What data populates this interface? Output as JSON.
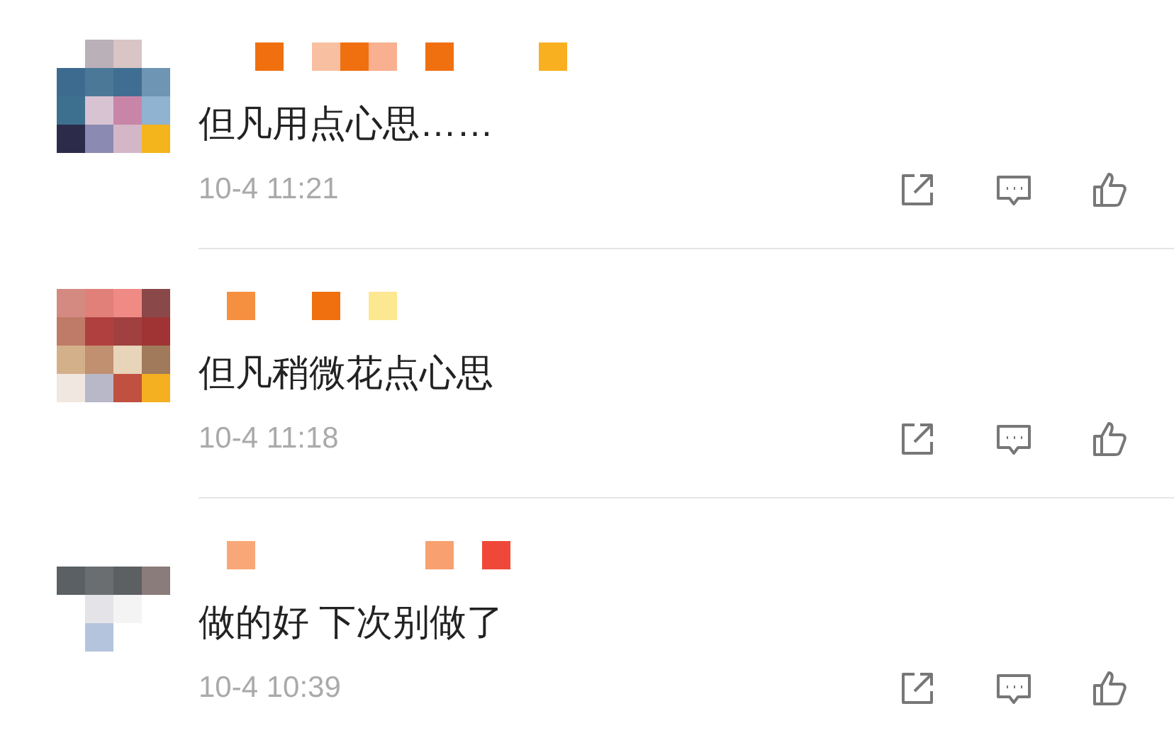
{
  "comments": [
    {
      "text": "但凡用点心思……",
      "time": "10-4 11:21"
    },
    {
      "text": "但凡稍微花点心思",
      "time": "10-4 11:18"
    },
    {
      "text": "做的好 下次别做了",
      "time": "10-4 10:39"
    }
  ]
}
